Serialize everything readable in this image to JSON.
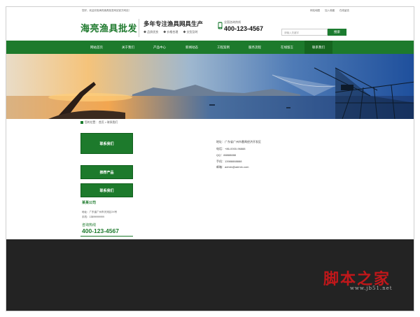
{
  "topbar": {
    "welcome": "您好，欢迎光临海亮渔具批发网站官方网站！",
    "links": [
      "网站地图",
      "加入收藏",
      "在线留言"
    ]
  },
  "header": {
    "logo": "海亮渔具批发",
    "slogan": "多年专注渔具网具生产",
    "features": [
      "◆ 品质优良",
      "◆ 价格合理",
      "◆ 交货及时"
    ],
    "hotline_label": "全国咨询热线",
    "hotline_number": "400-123-4567",
    "search_placeholder": "请输入关键字",
    "search_button": "搜索"
  },
  "nav": {
    "items": [
      "网站首页",
      "关于我们",
      "产品中心",
      "新闻动态",
      "工程案例",
      "服务流程",
      "在线留言",
      "联系我们"
    ],
    "active": "联系我们"
  },
  "breadcrumb": "您的位置： 首页 > 联系我们",
  "sidebar": {
    "contact_us": "联系我们",
    "recommended": "推荐产品",
    "contact_us_2": "联系我们",
    "company": "某某公司",
    "address": "地址：广东省广州市天河区XX号",
    "phone": "手机：13899999999",
    "hotline_label": "咨询热线",
    "hotline_number": "400-123-4567"
  },
  "contact": {
    "address": "地址：广东省广州市番禺经济开发区",
    "tel": "电话：+86-0000-96888",
    "qq": "QQ：88888888",
    "mobile": "手机：13988888888",
    "email": "邮箱：admin@admin.com"
  },
  "watermark": {
    "cn": "脚本之家",
    "url": "www.jb51.net"
  },
  "colors": {
    "brand_green": "#1d7a2c",
    "footer": "#232323"
  }
}
